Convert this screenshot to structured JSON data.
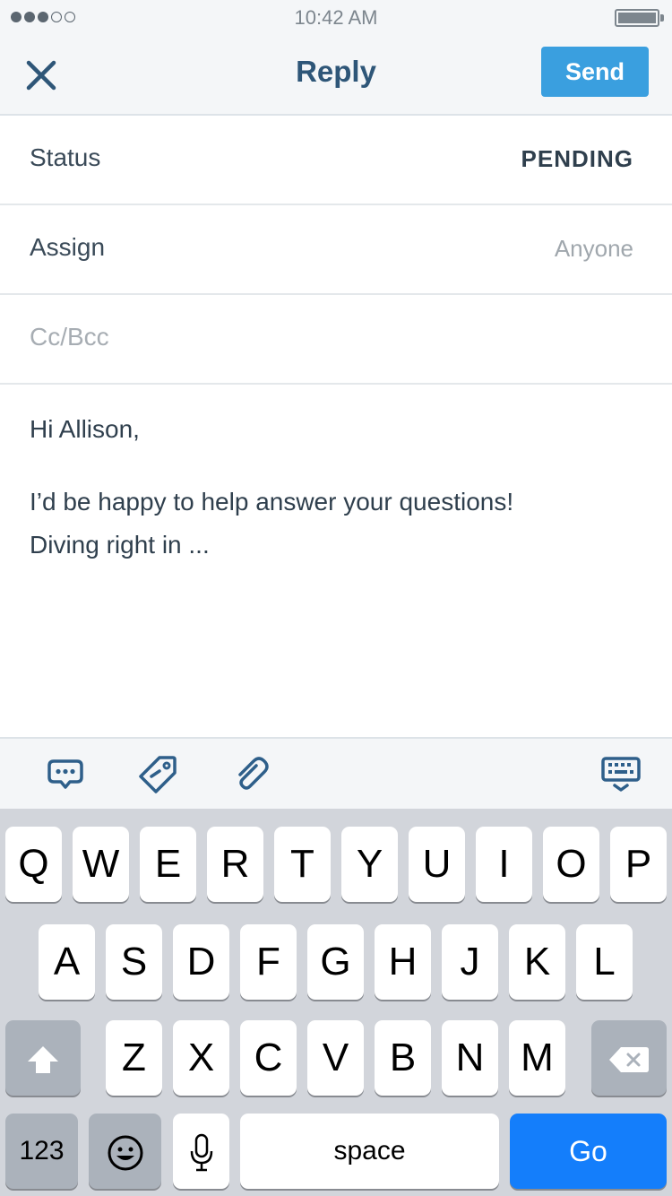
{
  "status_bar": {
    "time": "10:42 AM",
    "signal": {
      "filled": 3,
      "empty": 2
    },
    "battery_level": 1.0
  },
  "nav": {
    "close_icon": "close-x-icon",
    "title": "Reply",
    "send_label": "Send"
  },
  "fields": {
    "status_label": "Status",
    "status_value": "PENDING",
    "assign_label": "Assign",
    "assign_value": "Anyone",
    "cc_placeholder": "Cc/Bcc"
  },
  "message": {
    "greeting": "Hi Allison,",
    "line1": "I’d be happy to help answer your questions!",
    "line2": "Diving right in ..."
  },
  "toolbar": {
    "icons": [
      "saved-replies-icon",
      "tag-icon",
      "attachment-icon",
      "hide-keyboard-icon"
    ]
  },
  "keyboard": {
    "row1": [
      "Q",
      "W",
      "E",
      "R",
      "T",
      "Y",
      "U",
      "I",
      "O",
      "P"
    ],
    "row2": [
      "A",
      "S",
      "D",
      "F",
      "G",
      "H",
      "J",
      "K",
      "L"
    ],
    "row3": [
      "Z",
      "X",
      "C",
      "V",
      "B",
      "N",
      "M"
    ],
    "numbers_label": "123",
    "space_label": "space",
    "go_label": "Go"
  },
  "colors": {
    "accent": "#3a9fdf",
    "title": "#2e5678",
    "go_key": "#147efb"
  }
}
